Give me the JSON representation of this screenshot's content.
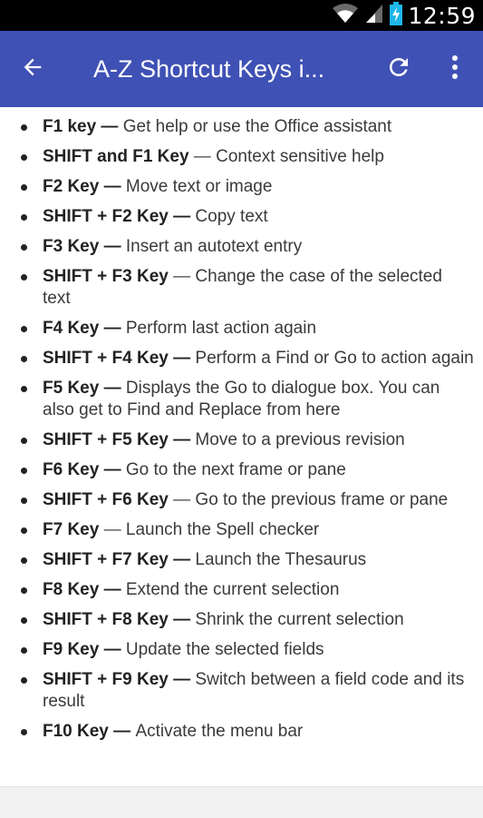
{
  "status_bar": {
    "time": "12:59",
    "icons": [
      "wifi-icon",
      "signal-icon",
      "battery-charging-icon"
    ]
  },
  "app_bar": {
    "title": "A-Z Shortcut Keys i...",
    "background": "#3f51b5",
    "back_icon": "arrow-back-icon",
    "refresh_icon": "refresh-icon",
    "menu_icon": "more-vert-icon"
  },
  "shortcuts": [
    {
      "key": "F1 key",
      "sep": " — ",
      "desc": "Get help or use the Office assistant"
    },
    {
      "key": "SHIFT and F1 Key",
      "sep": " — ",
      "desc": "Context sensitive help"
    },
    {
      "key": "F2 Key",
      "sep": " — ",
      "desc": "Move text or image"
    },
    {
      "key": "SHIFT + F2 Key",
      "sep": " — ",
      "desc": "Copy text"
    },
    {
      "key": "F3 Key",
      "sep": " — ",
      "desc": "Insert an autotext entry"
    },
    {
      "key": "SHIFT + F3 Key",
      "sep": " — ",
      "desc": "Change the case of the selected text"
    },
    {
      "key": "F4 Key",
      "sep": " — ",
      "desc": "Perform last action again"
    },
    {
      "key": "SHIFT + F4 Key",
      "sep": " — ",
      "desc": "Perform a Find or Go to action again"
    },
    {
      "key": "F5 Key",
      "sep": " — ",
      "desc": "Displays the Go to dialogue box. You can also get to Find and Replace from here"
    },
    {
      "key": "SHIFT + F5 Key",
      "sep": " — ",
      "desc": "Move to a previous revision"
    },
    {
      "key": "F6 Key",
      "sep": " — ",
      "desc": "Go to the next frame or pane"
    },
    {
      "key": "SHIFT + F6 Key",
      "sep": " — ",
      "desc": "Go to the previous frame or pane"
    },
    {
      "key": "F7 Key",
      "sep": " — ",
      "desc": "Launch the Spell checker"
    },
    {
      "key": "SHIFT + F7 Key",
      "sep": " — ",
      "desc": "Launch the Thesaurus"
    },
    {
      "key": "F8 Key",
      "sep": " — ",
      "desc": "Extend the current selection"
    },
    {
      "key": "SHIFT + F8 Key",
      "sep": " — ",
      "desc": "Shrink the current selection"
    },
    {
      "key": "F9 Key",
      "sep": " — ",
      "desc": "Update the selected fields"
    },
    {
      "key": "SHIFT + F9 Key",
      "sep": " — ",
      "desc": "Switch between a field code and its result"
    },
    {
      "key": "F10 Key",
      "sep": " — ",
      "desc": "Activate the menu bar"
    }
  ]
}
